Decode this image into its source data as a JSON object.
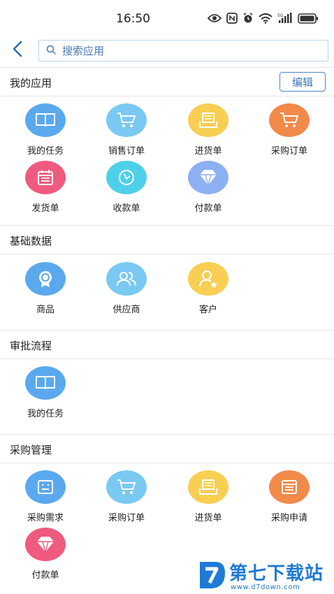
{
  "status_bar": {
    "time": "16:50",
    "icons": [
      "eye-icon",
      "nfc-icon",
      "alarm-icon",
      "wifi-icon",
      "5g-signal-icon",
      "battery-icon"
    ]
  },
  "search": {
    "placeholder": "搜索应用"
  },
  "sections": [
    {
      "title": "我的应用",
      "edit_label": "编辑",
      "items": [
        {
          "label": "我的任务",
          "icon": "book-icon",
          "color": "#5aa9ee"
        },
        {
          "label": "销售订单",
          "icon": "cart-icon",
          "color": "#7ac9f3"
        },
        {
          "label": "进货单",
          "icon": "box-icon",
          "color": "#f8cf52"
        },
        {
          "label": "采购订单",
          "icon": "cart-icon",
          "color": "#f28a4a"
        },
        {
          "label": "发货单",
          "icon": "calendar-icon",
          "color": "#ef5b7e"
        },
        {
          "label": "收款单",
          "icon": "clock-icon",
          "color": "#4fd0ea"
        },
        {
          "label": "付款单",
          "icon": "diamond-icon",
          "color": "#8db0f2"
        }
      ]
    },
    {
      "title": "基础数据",
      "items": [
        {
          "label": "商品",
          "icon": "badge-icon",
          "color": "#5aa9ee"
        },
        {
          "label": "供应商",
          "icon": "users-icon",
          "color": "#7ac9f3"
        },
        {
          "label": "客户",
          "icon": "user-star-icon",
          "color": "#f8cf52"
        }
      ]
    },
    {
      "title": "审批流程",
      "items": [
        {
          "label": "我的任务",
          "icon": "book-icon",
          "color": "#5aa9ee"
        }
      ]
    },
    {
      "title": "采购管理",
      "items": [
        {
          "label": "采购需求",
          "icon": "doc-icon",
          "color": "#5aa9ee"
        },
        {
          "label": "采购订单",
          "icon": "cart-icon",
          "color": "#7ac9f3"
        },
        {
          "label": "进货单",
          "icon": "box-icon",
          "color": "#f8cf52"
        },
        {
          "label": "采购申请",
          "icon": "form-icon",
          "color": "#f28a4a"
        },
        {
          "label": "付款单",
          "icon": "diamond-icon",
          "color": "#ef5b7e"
        }
      ]
    }
  ],
  "watermark": {
    "name": "第七下载站",
    "url": "www.d7down.com"
  }
}
